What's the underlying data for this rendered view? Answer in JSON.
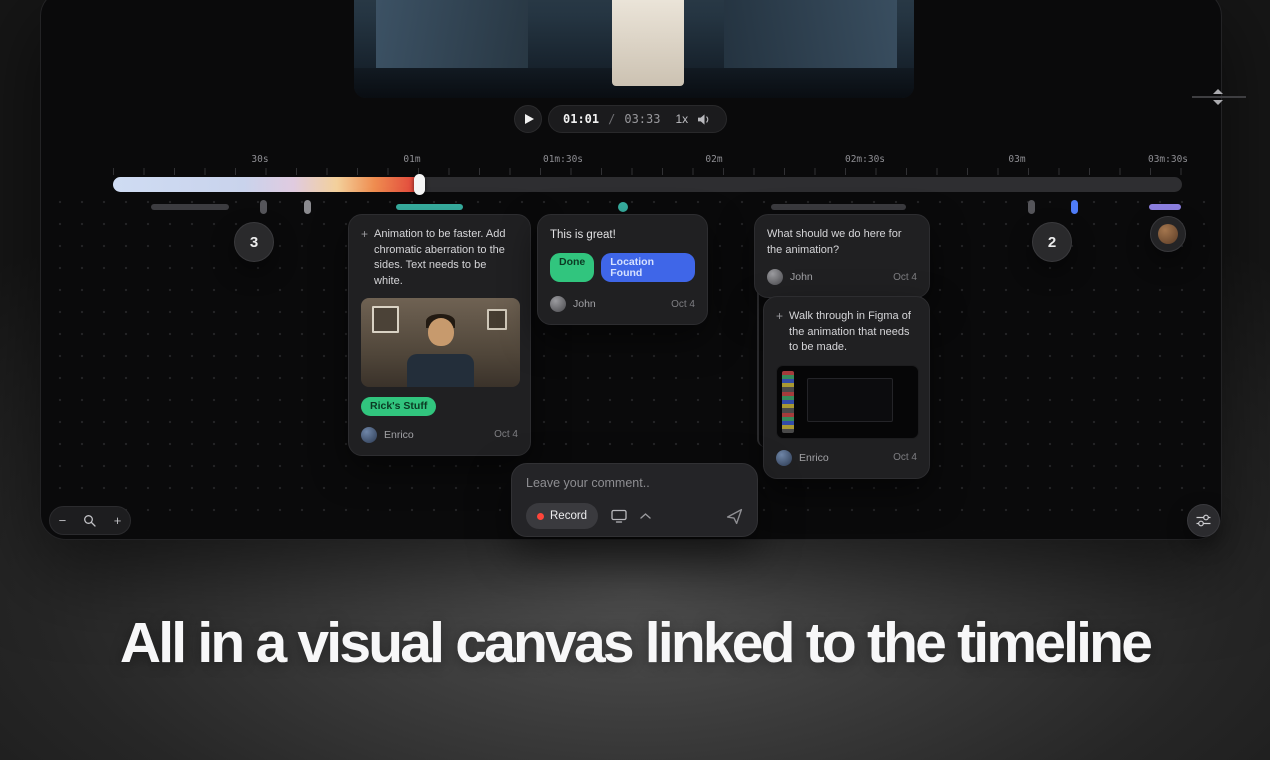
{
  "headline": "All in a visual canvas linked to the timeline",
  "app": {
    "player": {
      "current_time": "01:01",
      "time_separator": "/",
      "duration": "03:33",
      "speed": "1x"
    },
    "timeline": {
      "labels": [
        "30s",
        "01m",
        "01m:30s",
        "02m",
        "02m:30s",
        "03m",
        "03m:30s"
      ]
    },
    "canvas": {
      "cluster_badge_left": "3",
      "cluster_badge_right": "2",
      "cards": {
        "animation": {
          "icon": "+",
          "text": "Animation to be faster. Add chromatic aberration to the sides. Text needs to be white.",
          "tag": "Rick's Stuff",
          "author": "Enrico",
          "date": "Oct 4"
        },
        "great": {
          "text": "This is great!",
          "tags": [
            "Done",
            "Location Found"
          ],
          "author": "John",
          "date": "Oct 4"
        },
        "question": {
          "text": "What should we do here for the animation?",
          "author": "John",
          "date": "Oct 4"
        },
        "figma": {
          "icon": "+",
          "text": "Walk through in Figma of the animation that needs to be made.",
          "author": "Enrico",
          "date": "Oct 4"
        }
      }
    },
    "composer": {
      "placeholder": "Leave your comment..",
      "record_label": "Record"
    }
  },
  "icons": {
    "play": "play-triangle",
    "volume": "speaker",
    "zoom_out": "−",
    "search": "magnifier",
    "zoom_in": "+",
    "screen_share": "monitor",
    "expand": "chevron-up",
    "send": "paper-plane",
    "filter": "sliders"
  },
  "colors": {
    "tag_green": "#31c57e",
    "tag_blue": "#3f66e8",
    "segment_teal": "#38b2a3",
    "segment_blue": "#4f7cf7",
    "segment_purple": "#8c7fe0",
    "record_red": "#ff453a",
    "progress_start": "#cfdcf3",
    "progress_end": "#e2483c"
  }
}
